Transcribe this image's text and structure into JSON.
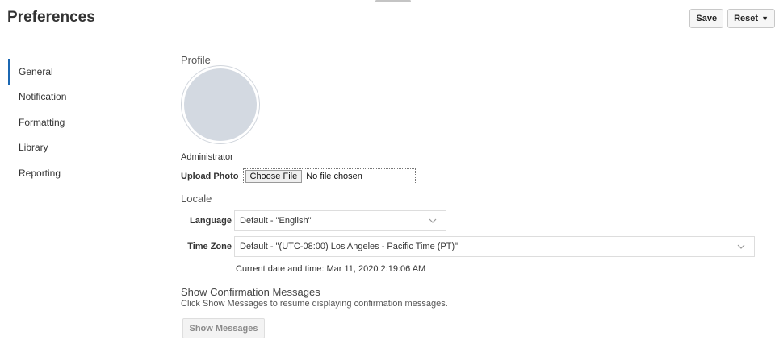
{
  "header": {
    "title": "Preferences"
  },
  "toolbar": {
    "save_label": "Save",
    "reset_label": "Reset"
  },
  "sidebar": {
    "active": "General",
    "items": [
      {
        "label": "General"
      },
      {
        "label": "Notification"
      },
      {
        "label": "Formatting"
      },
      {
        "label": "Library"
      },
      {
        "label": "Reporting"
      }
    ]
  },
  "profile": {
    "title": "Profile",
    "user_name": "Administrator",
    "upload_label": "Upload Photo",
    "choose_file_label": "Choose File",
    "file_status": "No file chosen"
  },
  "locale": {
    "title": "Locale",
    "language_label": "Language",
    "language_value": "Default - \"English\"",
    "timezone_label": "Time Zone",
    "timezone_value": "Default - \"(UTC-08:00) Los Angeles - Pacific Time (PT)\"",
    "current_time": "Current date and time: Mar 11, 2020 2:19:06 AM"
  },
  "confirmation": {
    "title": "Show Confirmation Messages",
    "description": "Click Show Messages to resume displaying confirmation messages.",
    "button_label": "Show Messages"
  },
  "icons": {
    "dropdown": "chevron-down-icon",
    "reset_caret": "caret-down-icon"
  },
  "colors": {
    "accent": "#1b67b2",
    "avatar": "#d3d9e1"
  }
}
